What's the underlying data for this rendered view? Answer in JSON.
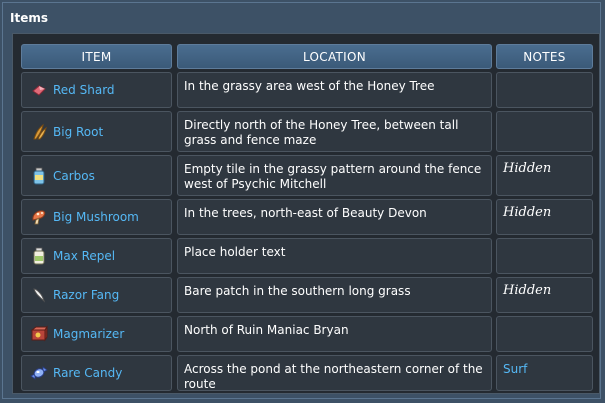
{
  "panel": {
    "title": "Items"
  },
  "table": {
    "headers": [
      "ITEM",
      "LOCATION",
      "NOTES"
    ],
    "rows": [
      {
        "item": "Red Shard",
        "icon": "red-shard-icon",
        "location": "In the grassy area west of the Honey Tree",
        "notes": ""
      },
      {
        "item": "Big Root",
        "icon": "big-root-icon",
        "location": "Directly north of the Honey Tree, between tall grass and fence maze",
        "notes": ""
      },
      {
        "item": "Carbos",
        "icon": "carbos-icon",
        "location": "Empty tile in the grassy pattern around the fence west of Psychic Mitchell",
        "notes": "Hidden"
      },
      {
        "item": "Big Mushroom",
        "icon": "big-mushroom-icon",
        "location": "In the trees, north-east of Beauty Devon",
        "notes": "Hidden"
      },
      {
        "item": "Max Repel",
        "icon": "max-repel-icon",
        "location": "Place holder text",
        "notes": ""
      },
      {
        "item": "Razor Fang",
        "icon": "razor-fang-icon",
        "location": "Bare patch in the southern long grass",
        "notes": "Hidden"
      },
      {
        "item": "Magmarizer",
        "icon": "magmarizer-icon",
        "location": "North of Ruin Maniac Bryan",
        "notes": ""
      },
      {
        "item": "Rare Candy",
        "icon": "rare-candy-icon",
        "location": "Across the pond at the northeastern corner of the route",
        "notes": "Surf"
      }
    ]
  },
  "colors": {
    "link": "#55b8f5",
    "header": "#4a6d90",
    "cell": "#2f3740"
  }
}
